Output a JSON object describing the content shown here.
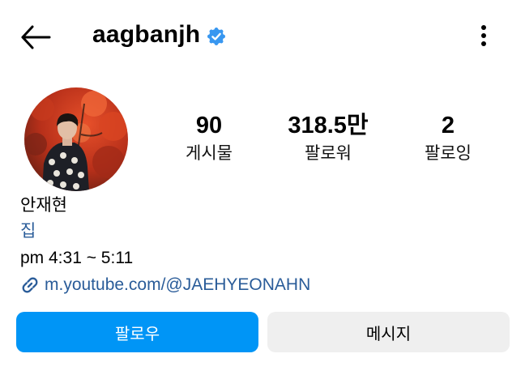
{
  "header": {
    "username": "aagbanjh",
    "verified": true
  },
  "icons": {
    "back": "back-arrow-icon",
    "verified": "verified-badge-icon",
    "more": "more-options-icon",
    "link": "link-icon"
  },
  "stats": [
    {
      "value": "90",
      "label": "게시물"
    },
    {
      "value": "318.5만",
      "label": "팔로워"
    },
    {
      "value": "2",
      "label": "팔로잉"
    }
  ],
  "bio": {
    "name": "안재현",
    "line1": "집",
    "line2": "pm 4:31 ~ 5:11",
    "link": "m.youtube.com/@JAEHYEONAHN"
  },
  "buttons": {
    "follow": "팔로우",
    "message": "메시지"
  },
  "colors": {
    "primary": "#0095f6",
    "link": "#2a5c99",
    "secondary_bg": "#efefef",
    "verified": "#3897f0"
  }
}
